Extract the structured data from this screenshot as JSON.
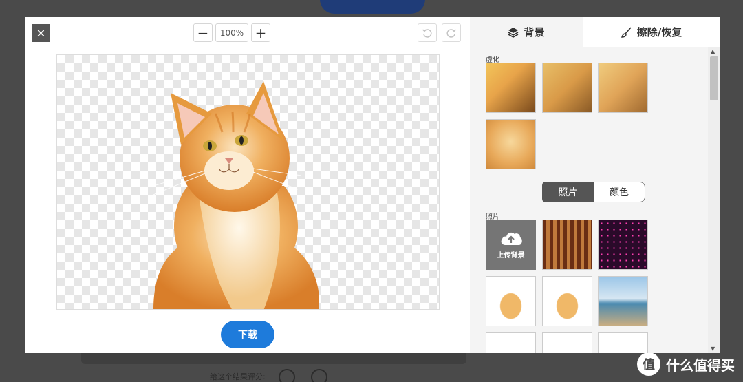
{
  "background_page": {
    "rating_prompt": "给这个结果评分:",
    "watermark": {
      "logo": "值",
      "text": "什么值得买"
    }
  },
  "toolbar": {
    "close_label": "✕",
    "zoom_out_label": "−",
    "zoom_value": "100%",
    "zoom_in_label": "+",
    "undo_icon": "undo-icon",
    "redo_icon": "redo-icon"
  },
  "canvas": {
    "subject": "cat-cutout",
    "background": "transparent-checkerboard"
  },
  "download_label": "下载",
  "tabs": [
    {
      "label": "背景",
      "icon": "layers-icon",
      "active": true
    },
    {
      "label": "擦除/恢复",
      "icon": "brush-icon",
      "active": false
    }
  ],
  "blur_section": {
    "title": "虚化",
    "items": [
      "blur-option-1",
      "blur-option-2",
      "blur-option-3",
      "blur-option-4"
    ]
  },
  "segment": {
    "options": [
      "照片",
      "颜色"
    ],
    "selected": "照片"
  },
  "photo_section": {
    "title": "照片",
    "upload_label": "上传背景",
    "upload_icon": "cloud-upload-icon",
    "items": [
      "bg-orange-stripes",
      "bg-pink-lights",
      "bg-white",
      "bg-white-2",
      "bg-beach-sky",
      "bg-white-3",
      "bg-white-4",
      "bg-white-5"
    ]
  },
  "colors": {
    "accent": "#1e7bdb",
    "dark_button": "#555555",
    "fur": "#e69a3e"
  }
}
